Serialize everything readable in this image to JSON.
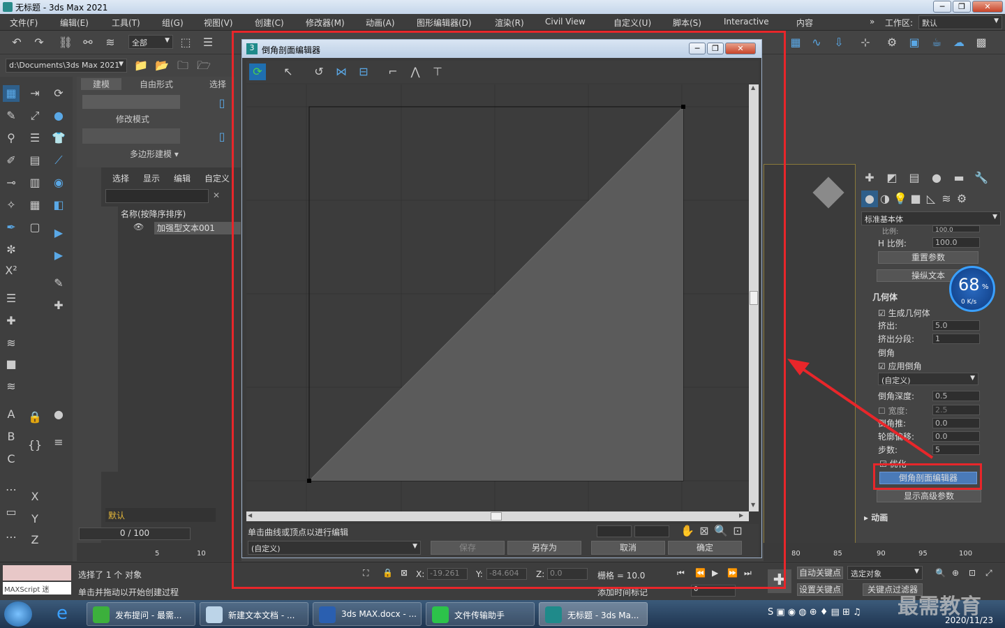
{
  "app": {
    "title": "无标题 - 3ds Max 2021",
    "window_controls": [
      "─",
      "❐",
      "✕"
    ]
  },
  "menu": [
    "文件(F)",
    "编辑(E)",
    "工具(T)",
    "组(G)",
    "视图(V)",
    "创建(C)",
    "修改器(M)",
    "动画(A)",
    "图形编辑器(D)",
    "渲染(R)",
    "Civil View",
    "自定义(U)",
    "脚本(S)",
    "Interactive",
    "内容"
  ],
  "workspace": {
    "label": "工作区:",
    "value": "默认"
  },
  "toolbar": {
    "selection_filter": "全部",
    "path": "d:\\Documents\\3ds Max 2021"
  },
  "ribbon": {
    "tabs": [
      "建模",
      "自由形式",
      "选择"
    ],
    "modify_mode": "修改模式",
    "poly_modeling": "多边形建模 ▾"
  },
  "scene_explorer": {
    "tabs": [
      "选择",
      "显示",
      "编辑",
      "自定义"
    ],
    "column": "名称(按降序排序)",
    "item": "加强型文本001",
    "layer": "默认",
    "frame": "0 / 100"
  },
  "dialog": {
    "title": "倒角剖面编辑器",
    "status_text": "单击曲线或顶点以进行编辑",
    "preset": "(自定义)",
    "buttons": {
      "save": "保存",
      "save_as": "另存为",
      "cancel": "取消",
      "ok": "确定"
    }
  },
  "command_panel": {
    "category": "标准基本体",
    "rows": {
      "ratio_top": "比例:",
      "ratio_top_value": "100.0",
      "h_ratio": "H 比例:",
      "h_ratio_value": "100.0",
      "reset_params": "重置参数",
      "manipulate_text": "操纵文本",
      "geometry_section": "几何体",
      "generate_geometry": "生成几何体",
      "extrude": "挤出:",
      "extrude_value": "5.0",
      "extrude_segments": "挤出分段:",
      "extrude_segments_value": "1",
      "bevel": "倒角",
      "apply_bevel": "应用倒角",
      "bevel_preset": "(自定义)",
      "bevel_depth": "倒角深度:",
      "bevel_depth_value": "0.5",
      "width": "宽度:",
      "width_value": "2.5",
      "bevel_push": "倒角推:",
      "bevel_push_value": "0.0",
      "outline_offset": "轮廓偏移:",
      "outline_offset_value": "0.0",
      "steps": "步数:",
      "steps_value": "5",
      "optimize": "优化",
      "bevel_profile_editor": "倒角剖面编辑器",
      "show_advanced": "显示高级参数",
      "animation_section": "动画"
    }
  },
  "net_meter": {
    "percent": "68",
    "unit": "%",
    "rate": "0 K/s"
  },
  "status": {
    "selected": "选择了 1 个 对象",
    "hint": "单击并拖动以开始创建过程",
    "maxscript": "MAXScript 迷",
    "x_label": "X:",
    "x_value": "-19.261",
    "y_label": "Y:",
    "y_value": "-84.604",
    "z_label": "Z:",
    "z_value": "0.0",
    "grid": "栅格 = 10.0",
    "add_time_tag": "添加时间标记",
    "auto_key": "自动关键点",
    "selected_obj": "选定对象",
    "set_key": "设置关键点",
    "key_filter": "关键点过滤器",
    "time_field": "0"
  },
  "timeline": {
    "ticks": [
      "5",
      "10",
      "80",
      "85",
      "90",
      "95",
      "100"
    ]
  },
  "taskbar": {
    "items": [
      "发布提问 - 最需...",
      "新建文本文档 - ...",
      "3ds MAX.docx - ...",
      "文件传输助手",
      "无标题 - 3ds Ma..."
    ],
    "clock": "2020/11/23",
    "watermark": "最需教育"
  },
  "colors": {
    "accent": "#5aa8e6",
    "highlight_red": "#e8262a",
    "profile_fill": "#5b5b5b"
  }
}
